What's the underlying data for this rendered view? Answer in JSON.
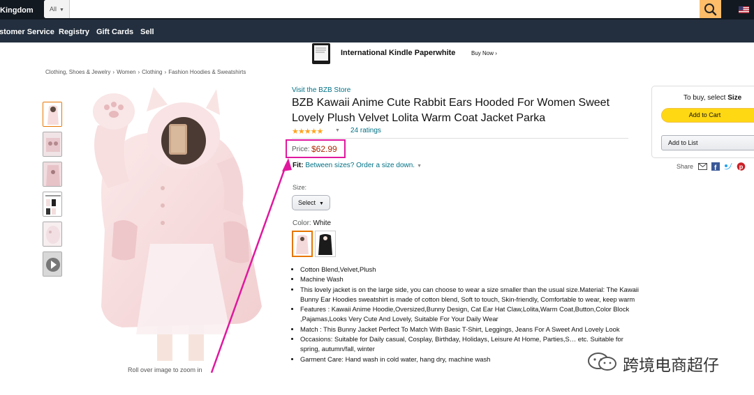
{
  "header": {
    "brand": "Kingdom",
    "search": {
      "category": "All",
      "placeholder": ""
    },
    "icons": {
      "search": "search-icon",
      "flag": "us-flag-icon"
    }
  },
  "nav": {
    "items": [
      "stomer Service",
      "Registry",
      "Gift Cards",
      "Sell"
    ]
  },
  "banner": {
    "title": "International Kindle Paperwhite",
    "cta": "Buy Now ›"
  },
  "breadcrumb": [
    "Clothing, Shoes & Jewelry",
    "Women",
    "Clothing",
    "Fashion Hoodies & Sweatshirts"
  ],
  "gallery": {
    "thumb_count": 6,
    "active_index": 0,
    "zoom_hint": "Roll over image to zoom in"
  },
  "product": {
    "store_link": "Visit the BZB Store",
    "title": "BZB Kawaii Anime Cute Rabbit Ears Hooded For Women Sweet Lovely Plush Velvet Lolita Warm Coat Jacket Parka",
    "rating_stars": "★★★★★",
    "rating_count": "24 ratings",
    "price_label": "Price:",
    "price": "$62.99",
    "fit_label": "Fit:",
    "fit_text": "Between sizes? Order a size down.",
    "size_label": "Size:",
    "size_select": "Select",
    "color_label": "Color:",
    "color_value": "White",
    "color_swatches": [
      "White",
      "Black"
    ],
    "bullets": [
      "Cotton Blend,Velvet,Plush",
      "Machine Wash",
      "This lovely jacket is on the large side, you can choose to wear a size smaller than the usual size.Material: The Kawaii Bunny Ear Hoodies sweatshirt is made of cotton blend, Soft to touch, Skin-friendly, Comfortable to wear, keep warm",
      "Features : Kawaii Anime Hoodie,Oversized,Bunny Design, Cat Ear Hat Claw,Lolita,Warm Coat,Button,Color Block ,Pajamas,Looks Very Cute And Lovely, Suitable For Your Daily Wear",
      "Match : This Bunny Jacket Perfect To Match With Basic T-Shirt, Leggings, Jeans For A Sweet And Lovely Look",
      "Occasions: Suitable for Daily casual, Cosplay, Birthday, Holidays, Leisure At Home, Parties,S… etc. Suitable for spring, autumn/fall, winter",
      "Garment Care: Hand wash in cold water, hang dry, machine wash"
    ]
  },
  "buybox": {
    "label_prefix": "To buy, select",
    "label_bold": "Size",
    "add_to_cart": "Add to Cart",
    "add_to_list": "Add to List",
    "share_label": "Share",
    "share_icons": [
      "email-icon",
      "facebook-icon",
      "twitter-icon",
      "pinterest-icon"
    ]
  },
  "annotation": {
    "highlight_color": "#e0189e"
  },
  "watermark": {
    "text": "跨境电商超仔",
    "icon": "wechat-icon"
  },
  "colors": {
    "header_bg": "#131921",
    "nav_bg": "#232f3e",
    "link": "#007185",
    "price": "#b12704",
    "cart_button": "#ffd814",
    "search_button": "#febd69",
    "star": "#ffa41c"
  }
}
